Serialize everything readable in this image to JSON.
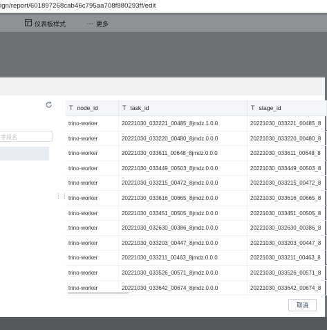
{
  "browser": {
    "url": "ign/report/601897268cab46c795aa708f880293ff/edit"
  },
  "toolbar": {
    "items": [
      {
        "icon": "dashboard-style-icon",
        "label": "仪表板样式"
      },
      {
        "icon": "more-dots-icon",
        "label": "更多"
      }
    ]
  },
  "left_panel": {
    "search_placeholder": "字段名",
    "refresh_icon": "refresh-icon"
  },
  "table": {
    "columns": [
      {
        "icon": "text-field-icon",
        "label": "node_id"
      },
      {
        "icon": "text-field-icon",
        "label": "task_id"
      },
      {
        "icon": "text-field-icon",
        "label": "stage_id"
      }
    ],
    "rows": [
      [
        "trino-worker",
        "20221030_033221_00485_8jmdz.1.0.0",
        "20221030_033221_00485_8"
      ],
      [
        "trino-worker",
        "20221030_033220_00480_8jmdz.0.0.0",
        "20221030_033220_00480_8"
      ],
      [
        "trino-worker",
        "20221030_033611_00648_8jmdz.0.0.0",
        "20221030_033611_00648_8"
      ],
      [
        "trino-worker",
        "20221030_033449_00503_8jmdz.0.0.0",
        "20221030_033449_00503_8"
      ],
      [
        "trino-worker",
        "20221030_033215_00472_8jmdz.0.0.0",
        "20221030_033215_00472_8"
      ],
      [
        "trino-worker",
        "20221030_033616_00665_8jmdz.0.0.0",
        "20221030_033616_00665_8"
      ],
      [
        "trino-worker",
        "20221030_033451_00505_8jmdz.0.0.0",
        "20221030_033451_00505_8"
      ],
      [
        "trino-worker",
        "20221030_032630_00386_8jmdz.0.0.0",
        "20221030_032630_00386_8"
      ],
      [
        "trino-worker",
        "20221030_033203_00447_8jmdz.0.0.0",
        "20221030_033203_00447_8"
      ],
      [
        "trino-worker",
        "20221030_033211_00463_8jmdz.0.0.0",
        "20221030_033211_00463_8"
      ],
      [
        "trino-worker",
        "20221030_033526_00571_8jmdz.0.0.0",
        "20221030_033526_00571_8"
      ],
      [
        "trino-worker",
        "20221030_033642_00674_8jmdz.0.0.0",
        "20221030_033642_00674_8"
      ]
    ]
  },
  "footer": {
    "cancel_label": "取消"
  }
}
